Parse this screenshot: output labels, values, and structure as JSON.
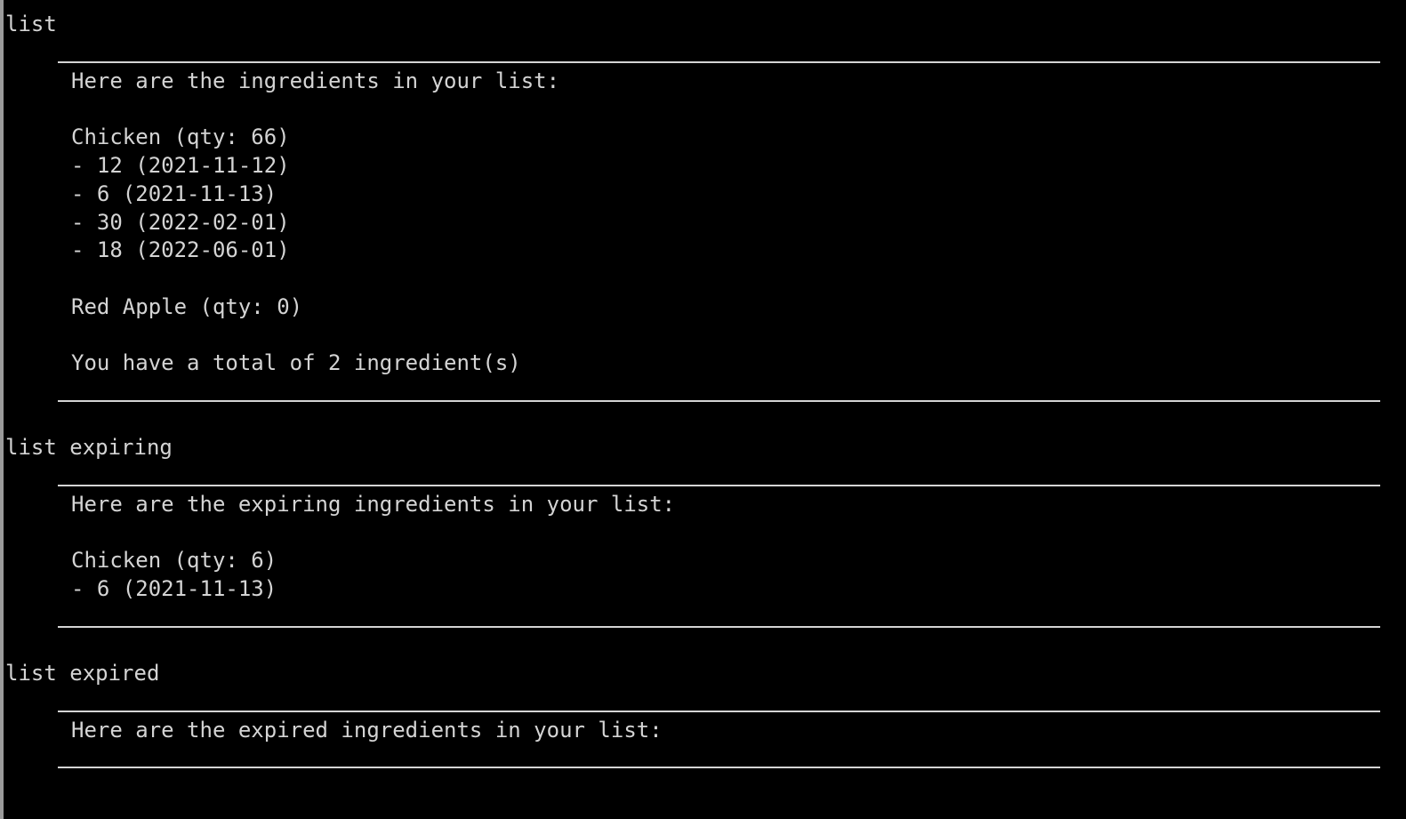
{
  "colors": {
    "background": "#000000",
    "text": "#d4d4d4"
  },
  "blocks": [
    {
      "command": "list",
      "output": [
        "Here are the ingredients in your list:",
        "",
        "Chicken (qty: 66)",
        "- 12 (2021-11-12)",
        "- 6 (2021-11-13)",
        "- 30 (2022-02-01)",
        "- 18 (2022-06-01)",
        "",
        "Red Apple (qty: 0)",
        "",
        "You have a total of 2 ingredient(s)"
      ]
    },
    {
      "command": "list expiring",
      "output": [
        "Here are the expiring ingredients in your list:",
        "",
        "Chicken (qty: 6)",
        "- 6 (2021-11-13)"
      ]
    },
    {
      "command": "list expired",
      "output": [
        "Here are the expired ingredients in your list:"
      ]
    }
  ]
}
